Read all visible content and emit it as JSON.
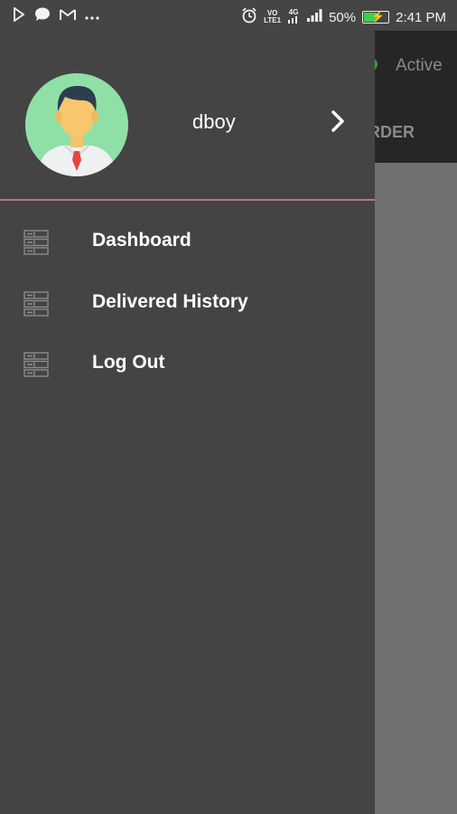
{
  "status_bar": {
    "left_icons": [
      "play-store-icon",
      "chat-icon",
      "gmail-icon",
      "more-dots-icon"
    ],
    "volte_top": "VO",
    "volte_bottom": "LTE1",
    "signal_label": "4G",
    "battery": "50%",
    "battery_level": 0.5,
    "time": "2:41 PM"
  },
  "background": {
    "status_text": "Active",
    "tab_text": "RDER",
    "status_color": "#2ea043"
  },
  "drawer": {
    "username": "dboy",
    "divider_color": "#b07a76",
    "menu": [
      {
        "label": "Dashboard",
        "icon": "list-icon"
      },
      {
        "label": "Delivered History",
        "icon": "list-icon"
      },
      {
        "label": "Log Out",
        "icon": "list-icon"
      }
    ]
  }
}
